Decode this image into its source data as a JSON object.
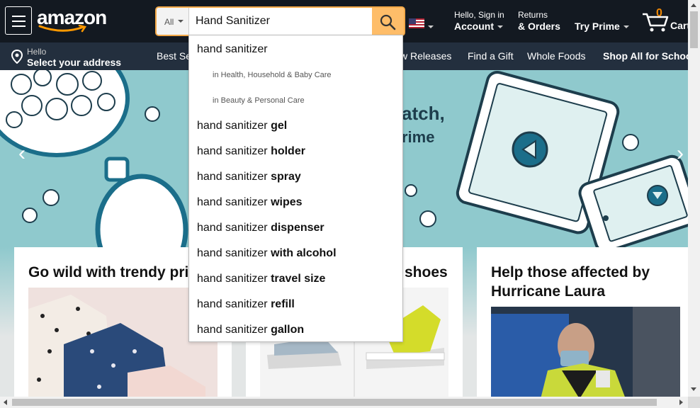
{
  "header": {
    "logo_text": "amazon",
    "search": {
      "category": "All",
      "value": "Hand Sanitizer"
    },
    "account": {
      "greeting": "Hello, Sign in",
      "label": "Account"
    },
    "orders": {
      "line1": "Returns",
      "line2": "& Orders"
    },
    "prime": "Try Prime",
    "cart": {
      "count": "0",
      "label": "Cart"
    }
  },
  "subnav": {
    "location": {
      "line1": "Hello",
      "line2": "Select your address"
    },
    "links": [
      "Best Se",
      "w Releases",
      "Find a Gift",
      "Whole Foods"
    ],
    "right_link": "Shop All for Schoo"
  },
  "hero": {
    "text1": "atch,",
    "text2": "rime"
  },
  "cards": [
    {
      "title": "Go wild with trendy pri"
    },
    {
      "title": "shoes"
    },
    {
      "title_line1": "Help those affected by",
      "title_line2": "Hurricane Laura"
    }
  ],
  "suggestions": [
    {
      "prefix": "hand sanitizer",
      "suffix": ""
    },
    {
      "dept_prefix": "in",
      "dept": "Health, Household & Baby Care"
    },
    {
      "dept_prefix": "in",
      "dept": "Beauty & Personal Care"
    },
    {
      "prefix": "hand sanitizer ",
      "suffix": "gel"
    },
    {
      "prefix": "hand sanitizer ",
      "suffix": "holder"
    },
    {
      "prefix": "hand sanitizer ",
      "suffix": "spray"
    },
    {
      "prefix": "hand sanitizer ",
      "suffix": "wipes"
    },
    {
      "prefix": "hand sanitizer ",
      "suffix": "dispenser"
    },
    {
      "prefix": "hand sanitizer ",
      "suffix": "with alcohol"
    },
    {
      "prefix": "hand sanitizer ",
      "suffix": "travel size"
    },
    {
      "prefix": "hand sanitizer ",
      "suffix": "refill"
    },
    {
      "prefix": "hand sanitizer ",
      "suffix": "gallon"
    }
  ],
  "colors": {
    "nav_dark": "#131921",
    "nav_sub": "#232f3e",
    "search_button": "#febd69",
    "search_focus": "#f3a847",
    "cart_count": "#f08804",
    "hero_bg": "#8fc9cd"
  },
  "icons": [
    "menu-icon",
    "search-icon",
    "us-flag-icon",
    "location-pin-icon",
    "cart-icon",
    "chevron-left-icon",
    "chevron-right-icon"
  ]
}
